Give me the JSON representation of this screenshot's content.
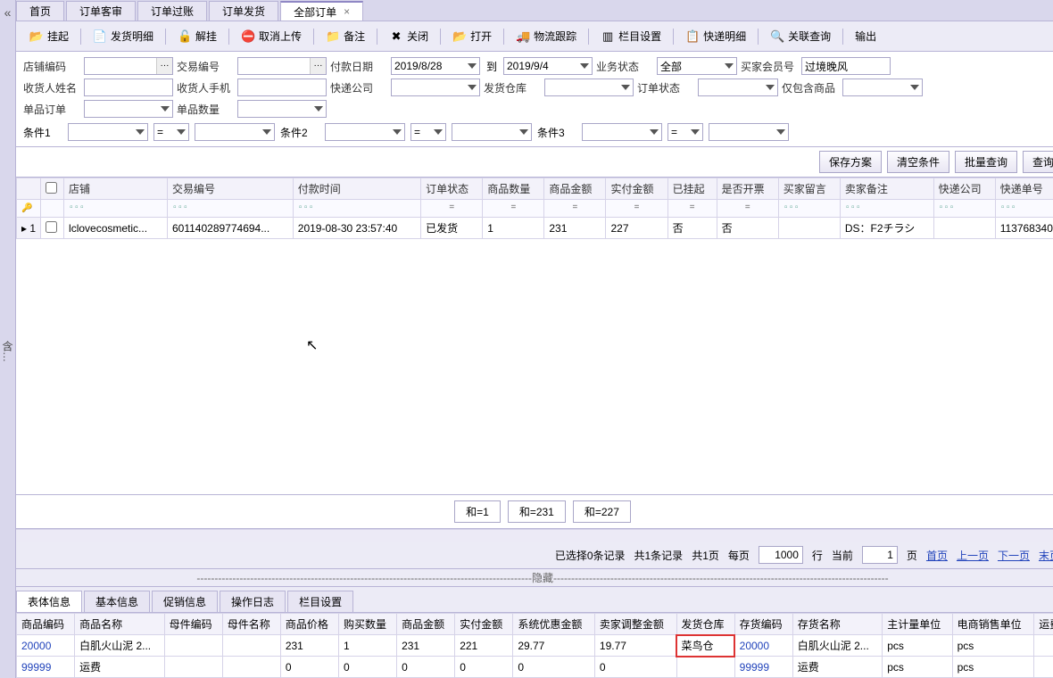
{
  "sidebar_text": "含…",
  "tabs": [
    "首页",
    "订单客审",
    "订单过账",
    "订单发货",
    "全部订单"
  ],
  "active_tab_index": 4,
  "toolbar": [
    {
      "icon": "📂",
      "label": "挂起"
    },
    {
      "icon": "📄",
      "label": "发货明细"
    },
    {
      "icon": "🔓",
      "label": "解挂"
    },
    {
      "icon": "⛔",
      "label": "取消上传"
    },
    {
      "icon": "📁",
      "label": "备注"
    },
    {
      "icon": "✖",
      "label": "关闭"
    },
    {
      "icon": "📂",
      "label": "打开"
    },
    {
      "icon": "🚚",
      "label": "物流跟踪"
    },
    {
      "icon": "▥",
      "label": "栏目设置"
    },
    {
      "icon": "📋",
      "label": "快递明细"
    },
    {
      "icon": "🔍",
      "label": "关联查询"
    },
    {
      "icon": "",
      "label": "输出"
    }
  ],
  "filters": {
    "store_code": {
      "label": "店铺编码",
      "value": ""
    },
    "trade_no": {
      "label": "交易编号",
      "value": ""
    },
    "pay_date": {
      "label": "付款日期",
      "from": "2019/8/28",
      "to_label": "到",
      "to": "2019/9/4"
    },
    "biz_status": {
      "label": "业务状态",
      "value": "全部"
    },
    "buyer_id": {
      "label": "买家会员号",
      "value": "过境晚风"
    },
    "recv_name": {
      "label": "收货人姓名",
      "value": ""
    },
    "recv_phone": {
      "label": "收货人手机",
      "value": ""
    },
    "express_co": {
      "label": "快递公司",
      "value": ""
    },
    "ship_wh": {
      "label": "发货仓库",
      "value": ""
    },
    "order_status": {
      "label": "订单状态",
      "value": ""
    },
    "only_contain": {
      "label": "仅包含商品",
      "value": ""
    },
    "single_order": {
      "label": "单品订单",
      "value": ""
    },
    "single_qty": {
      "label": "单品数量",
      "value": ""
    }
  },
  "conds": [
    {
      "label": "条件1",
      "v1": "",
      "op": "=",
      "v2": ""
    },
    {
      "label": "条件2",
      "v1": "",
      "op": "=",
      "v2": ""
    },
    {
      "label": "条件3",
      "v1": "",
      "op": "=",
      "v2": ""
    }
  ],
  "actions": {
    "save": "保存方案",
    "clear": "清空条件",
    "batch": "批量查询",
    "query": "查询"
  },
  "grid": {
    "columns": [
      "店铺",
      "交易编号",
      "付款时间",
      "订单状态",
      "商品数量",
      "商品金额",
      "实付金额",
      "已挂起",
      "是否开票",
      "买家留言",
      "卖家备注",
      "快递公司",
      "快递单号"
    ],
    "filter_tag": "▫▫▫",
    "eq": "=",
    "rows": [
      {
        "idx": "1",
        "store": "lclovecosmetic...",
        "trade": "601140289774694...",
        "paytime": "2019-08-30 23:57:40",
        "status": "已发货",
        "qty": "1",
        "amount": "231",
        "paid": "227",
        "pending": "否",
        "invoice": "否",
        "buyer_msg": "",
        "seller_note": "DS：F2チラシ",
        "express": "",
        "expno": "113768340"
      }
    ]
  },
  "sums": [
    "和=1",
    "和=231",
    "和=227"
  ],
  "pager": {
    "selected": "已选择0条记录",
    "total_rec": "共1条记录",
    "total_page": "共1页",
    "per_page_label": "每页",
    "per_page": "1000",
    "row_word": "行",
    "current_label": "当前",
    "current": "1",
    "page_word": "页",
    "first": "首页",
    "prev": "上一页",
    "next": "下一页",
    "last": "末页"
  },
  "collapse_text": "----------------------------------------------------------------------------------------------隐藏----------------------------------------------------------------------------------------------",
  "detail_tabs": [
    "表体信息",
    "基本信息",
    "促销信息",
    "操作日志",
    "栏目设置"
  ],
  "detail_active": 0,
  "detail": {
    "columns": [
      "商品编码",
      "商品名称",
      "母件编码",
      "母件名称",
      "商品价格",
      "购买数量",
      "商品金额",
      "实付金额",
      "系统优惠金额",
      "卖家调整金额",
      "发货仓库",
      "存货编码",
      "存货名称",
      "主计量单位",
      "电商销售单位",
      "运费"
    ],
    "rows": [
      {
        "code": "20000",
        "name": "白肌火山泥 2...",
        "pcode": "",
        "pname": "",
        "price": "231",
        "qty": "1",
        "amount": "231",
        "paid": "221",
        "sys_disc": "29.77",
        "seller_adj": "19.77",
        "wh": "菜鸟仓",
        "inv_code": "20000",
        "inv_name": "白肌火山泥 2...",
        "unit": "pcs",
        "eunit": "pcs"
      },
      {
        "code": "99999",
        "name": "运费",
        "pcode": "",
        "pname": "",
        "price": "0",
        "qty": "0",
        "amount": "0",
        "paid": "0",
        "sys_disc": "0",
        "seller_adj": "0",
        "wh": "",
        "inv_code": "99999",
        "inv_name": "运费",
        "unit": "pcs",
        "eunit": "pcs"
      }
    ]
  }
}
